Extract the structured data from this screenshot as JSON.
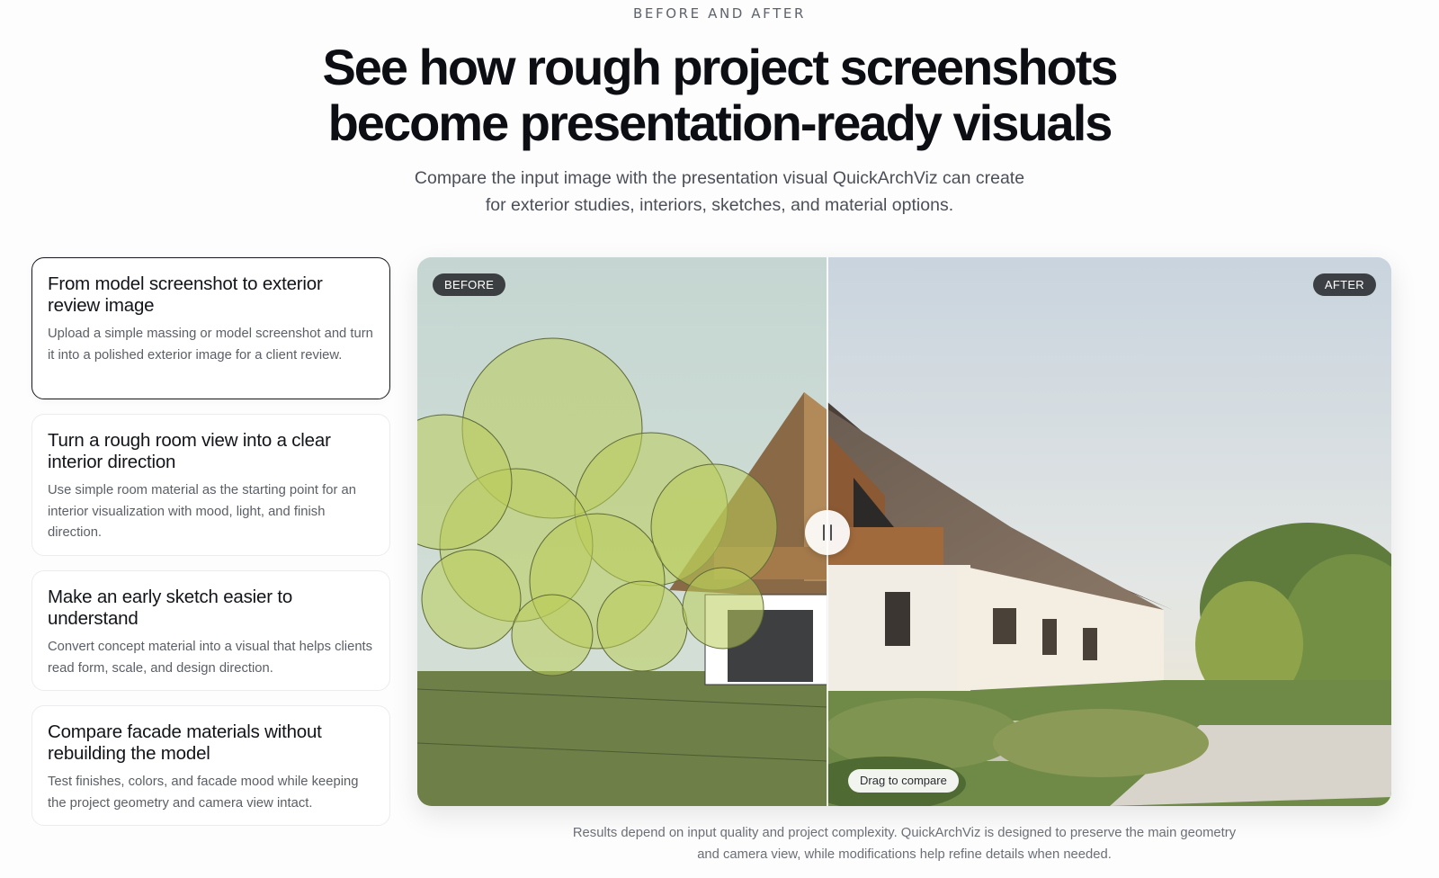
{
  "section": {
    "eyebrow": "BEFORE AND AFTER",
    "headline_line1": "See how rough project screenshots",
    "headline_line2": "become presentation-ready visuals",
    "subhead_line1": "Compare the input image with the presentation visual QuickArchViz can create",
    "subhead_line2": "for exterior studies, interiors, sketches, and material options."
  },
  "cards": [
    {
      "title": "From model screenshot to exterior review image",
      "description": "Upload a simple massing or model screenshot and turn it into a polished exterior image for a client review.",
      "active": true
    },
    {
      "title": "Turn a rough room view into a clear interior direction",
      "description": "Use simple room material as the starting point for an interior visualization with mood, light, and finish direction.",
      "active": false
    },
    {
      "title": "Make an early sketch easier to understand",
      "description": "Convert concept material into a visual that helps clients read form, scale, and design direction.",
      "active": false
    },
    {
      "title": "Compare facade materials without rebuilding the model",
      "description": "Test finishes, colors, and facade mood while keeping the project geometry and camera view intact.",
      "active": false
    }
  ],
  "compare": {
    "before_label": "BEFORE",
    "after_label": "AFTER",
    "drag_hint": "Drag to compare",
    "split_fraction": 0.42
  },
  "footnote": {
    "line1": "Results depend on input quality and project complexity. QuickArchViz is designed to preserve the main geometry",
    "line2": "and camera view, while modifications help refine details when needed."
  },
  "colors": {
    "text_primary": "#0c0e13",
    "text_muted": "#5b5f66",
    "active_border": "#16181d",
    "pill_dark": "#282a2e"
  }
}
